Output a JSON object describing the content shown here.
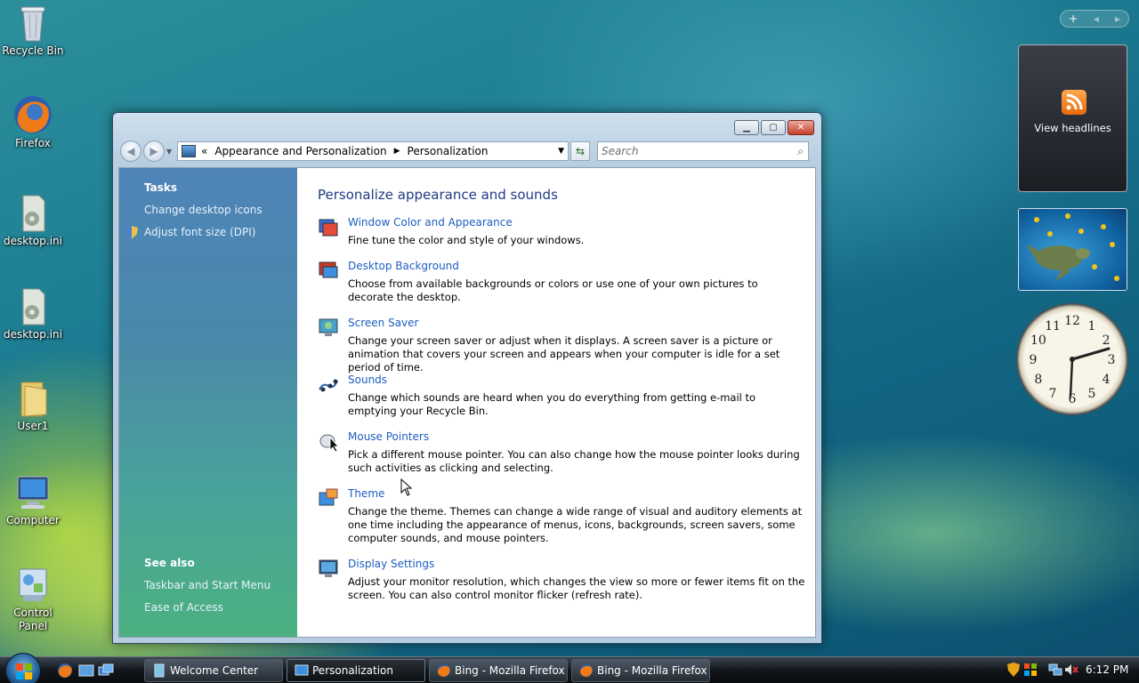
{
  "desktop": {
    "icons": [
      {
        "label": "Recycle Bin"
      },
      {
        "label": "Firefox"
      },
      {
        "label": "desktop.ini"
      },
      {
        "label": "desktop.ini"
      },
      {
        "label": "User1"
      },
      {
        "label": "Computer"
      },
      {
        "label": "Control Panel"
      }
    ]
  },
  "window": {
    "address": {
      "crumbs": [
        "Appearance and Personalization",
        "Personalization"
      ]
    },
    "search_placeholder": "Search",
    "left": {
      "tasks_heading": "Tasks",
      "tasks": [
        "Change desktop icons",
        "Adjust font size (DPI)"
      ],
      "see_also_heading": "See also",
      "see_also": [
        "Taskbar and Start Menu",
        "Ease of Access"
      ]
    },
    "main": {
      "title": "Personalize appearance and sounds",
      "items": [
        {
          "title": "Window Color and Appearance",
          "desc": "Fine tune the color and style of your windows.",
          "icon": "window-color-icon"
        },
        {
          "title": "Desktop Background",
          "desc": "Choose from available backgrounds or colors or use one of your own pictures to decorate the desktop.",
          "icon": "desktop-background-icon"
        },
        {
          "title": "Screen Saver",
          "desc": "Change your screen saver or adjust when it displays. A screen saver is a picture or animation that covers your screen and appears when your computer is idle for a set period of time.",
          "icon": "screen-saver-icon"
        },
        {
          "title": "Sounds",
          "desc": "Change which sounds are heard when you do everything from getting e-mail to emptying your Recycle Bin.",
          "icon": "sounds-icon"
        },
        {
          "title": "Mouse Pointers",
          "desc": "Pick a different mouse pointer. You can also change how the mouse pointer looks during such activities as clicking and selecting.",
          "icon": "mouse-icon"
        },
        {
          "title": "Theme",
          "desc": "Change the theme. Themes can change a wide range of visual and auditory elements at one time including the appearance of menus, icons, backgrounds, screen savers, some computer sounds, and mouse pointers.",
          "icon": "theme-icon"
        },
        {
          "title": "Display Settings",
          "desc": "Adjust your monitor resolution, which changes the view so more or fewer items fit on the screen. You can also control monitor flicker (refresh rate).",
          "icon": "display-icon"
        }
      ]
    }
  },
  "sidebar": {
    "rss_label": "View headlines",
    "clock_numbers": [
      "12",
      "1",
      "2",
      "3",
      "4",
      "5",
      "6",
      "7",
      "8",
      "9",
      "10",
      "11"
    ]
  },
  "taskbar": {
    "buttons": [
      {
        "label": "Welcome Center"
      },
      {
        "label": "Personalization"
      },
      {
        "label": "Bing - Mozilla Firefox"
      },
      {
        "label": "Bing - Mozilla Firefox"
      }
    ],
    "time": "6:12 PM"
  }
}
